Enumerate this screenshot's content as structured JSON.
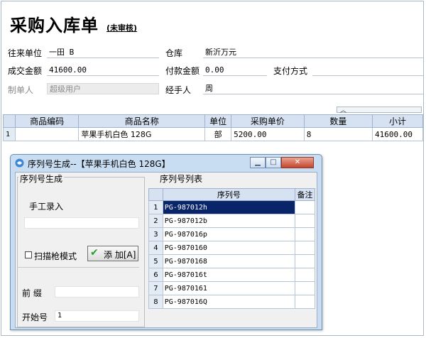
{
  "form": {
    "title": "采购入库单",
    "status": "(未审核)",
    "fields": {
      "partner_label": "往来单位",
      "partner_value": "一田 B",
      "warehouse_label": "仓库",
      "warehouse_value": "新沂万元",
      "amount_label": "成交金额",
      "amount_value": "41600.00",
      "paid_label": "付款金额",
      "paid_value": "0.00",
      "payment_label": "支付方式",
      "payment_value": "",
      "creator_label": "制单人",
      "creator_value": "超级用户",
      "handler_label": "经手人",
      "handler_value": "周"
    }
  },
  "grid": {
    "columns": [
      "",
      "商品编码",
      "商品名称",
      "单位",
      "采购单价",
      "数量",
      "小计"
    ],
    "rows": [
      {
        "n": "1",
        "code": "",
        "name": "苹果手机白色 128G",
        "unit": "部",
        "price": "5200.00",
        "qty": "8",
        "subtotal": "41600.00"
      }
    ]
  },
  "dialog": {
    "title": "序列号生成--【苹果手机白色 128G】",
    "gen_group": "序列号生成",
    "manual_label": "手工录入",
    "manual_value": "",
    "scan_label": "扫描枪模式",
    "add_label": "添 加[A]",
    "prefix_label": "前  缀",
    "prefix_value": "",
    "start_label": "开始号",
    "start_value": "1",
    "list_group": "序列号列表",
    "list_columns": [
      "",
      "序列号",
      "备注"
    ],
    "serials": [
      {
        "n": "1",
        "sn": "PG-987012h",
        "note": ""
      },
      {
        "n": "2",
        "sn": "PG-987012b",
        "note": ""
      },
      {
        "n": "3",
        "sn": "PG-987016p",
        "note": ""
      },
      {
        "n": "4",
        "sn": "PG-9870160",
        "note": ""
      },
      {
        "n": "5",
        "sn": "PG-9870168",
        "note": ""
      },
      {
        "n": "6",
        "sn": "PG-987016t",
        "note": ""
      },
      {
        "n": "7",
        "sn": "PG-9870161",
        "note": ""
      },
      {
        "n": "8",
        "sn": "PG-987016Q",
        "note": ""
      }
    ]
  },
  "colors": {
    "header_bg": "#d6e2f1",
    "selection": "#0a246a",
    "dialog_frame": "#c9ddf2"
  },
  "icons": {
    "dialog": "app-icon",
    "minimize": "minimize-icon",
    "maximize": "maximize-icon",
    "close": "close-icon",
    "add": "checkmark-icon"
  }
}
